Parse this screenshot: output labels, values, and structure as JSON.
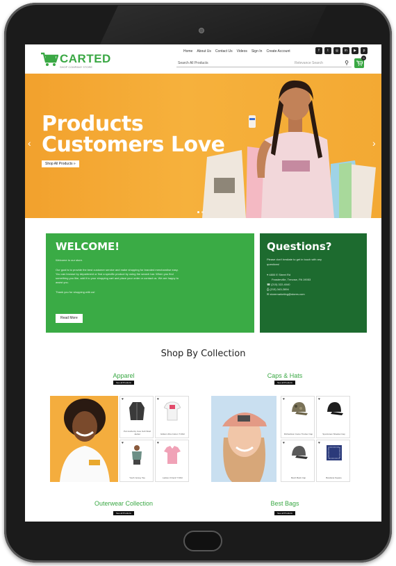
{
  "header": {
    "logo": "CARTED",
    "logo_tagline": "SHOP COMPANY STORE",
    "nav": [
      "Home",
      "About Us",
      "Contact Us",
      "Videos",
      "Sign In",
      "Create Account"
    ],
    "search_placeholder": "Search All Products",
    "search_options": "Relevance  Search",
    "cart_count": "0"
  },
  "hero": {
    "title_line1": "Products",
    "title_line2": "Customers Love",
    "button": "Shop All Products »",
    "prev": "‹",
    "next": "›"
  },
  "welcome": {
    "title": "WELCOME!",
    "lines": [
      "Welcome to our store.",
      "Our goal is to provide the best customer service and make shopping for branded merchandise easy.",
      "You can browse by department or find a specific product by using the search bar. When you find",
      "something you like, add it to your shopping cart and place your order or contact us. We are happy to",
      "assist you.",
      "Thank you for shopping with us!"
    ],
    "read_more": "Read More"
  },
  "questions": {
    "title": "Questions?",
    "intro_1": "Please don't hesitate to get in touch with any",
    "intro_2": "questions!",
    "address_1": "4800 E Street Rd",
    "address_2": "Feasterville, Trevose, PA 19053",
    "phone": "(215) 322-4040",
    "fax": "(215) 343-2894",
    "email": "storemarketing@stores.com"
  },
  "shop_by_collection": "Shop By Collection",
  "collections": [
    {
      "title": "Apparel",
      "button": "See all Products",
      "products": [
        "Port Authority Core Soft Shell Jacket",
        "Gildan Ultra Cotton T-Shirt",
        "Youth Jersey Tee",
        "Ladies V-Neck T-Shirt"
      ]
    },
    {
      "title": "Caps & Hats",
      "button": "See all Products",
      "products": [
        "Richardson Camo Trucker Cap",
        "Sportsman Shadow Cap",
        "Mesh Back Cap",
        "Bandana Square"
      ]
    },
    {
      "title": "Outerwear Collection",
      "button": "See all Products"
    },
    {
      "title": "Best Bags",
      "button": "See all Products"
    }
  ],
  "colors": {
    "brand_green": "#3aa844",
    "dark_green": "#1d6b2f",
    "hero_orange": "#f3a933"
  }
}
